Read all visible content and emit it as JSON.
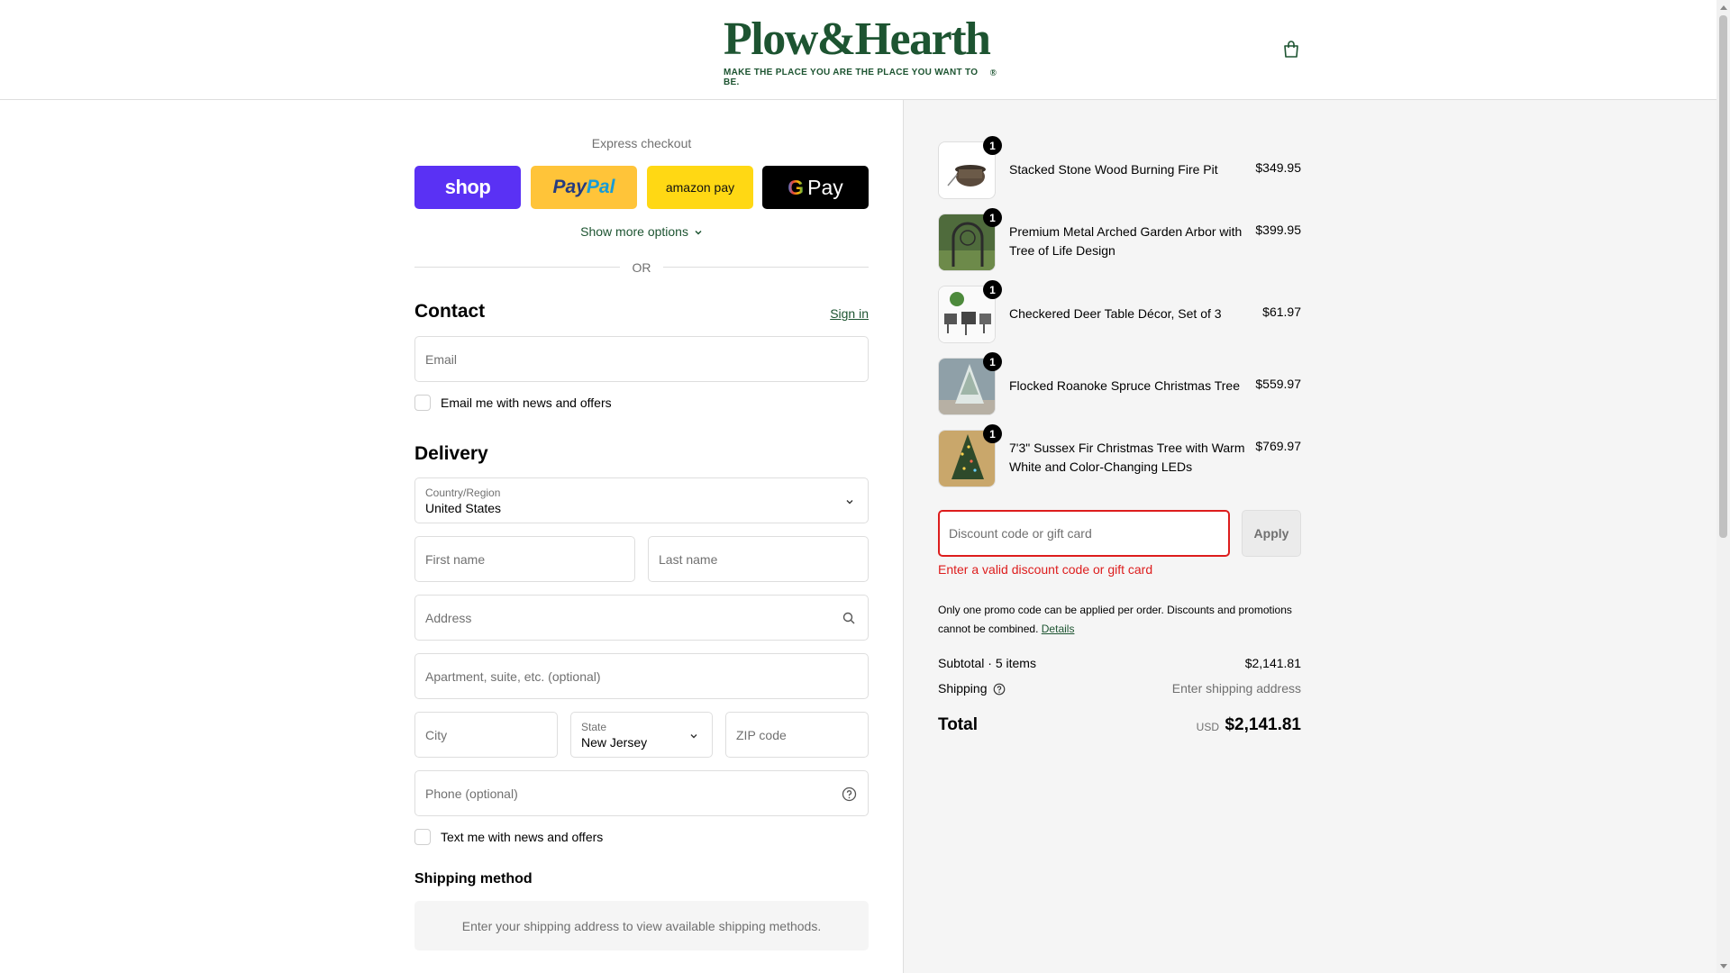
{
  "header": {
    "logo_word": "Plow&Hearth",
    "logo_reg": "®",
    "logo_tagline": "MAKE THE PLACE YOU ARE THE PLACE YOU WANT TO BE.",
    "brand_color": "#1d5431"
  },
  "express": {
    "title": "Express checkout",
    "shop_label": "shop",
    "paypal_label_1": "Pay",
    "paypal_label_2": "Pal",
    "amazon_label": "amazon pay",
    "gpay_g": "G",
    "gpay_label": "Pay",
    "more_options": "Show more options",
    "or": "OR"
  },
  "contact": {
    "title": "Contact",
    "sign_in": "Sign in",
    "email_placeholder": "Email",
    "email_news": "Email me with news and offers"
  },
  "delivery": {
    "title": "Delivery",
    "country_label": "Country/Region",
    "country_value": "United States",
    "first_name": "First name",
    "last_name": "Last name",
    "address": "Address",
    "apartment": "Apartment, suite, etc. (optional)",
    "city": "City",
    "state_label": "State",
    "state_value": "New Jersey",
    "zip": "ZIP code",
    "phone": "Phone (optional)",
    "text_news": "Text me with news and offers"
  },
  "shipping": {
    "title": "Shipping method",
    "message": "Enter your shipping address to view available shipping methods."
  },
  "items": [
    {
      "qty": "1",
      "name": "Stacked Stone Wood Burning Fire Pit",
      "price": "$349.95"
    },
    {
      "qty": "1",
      "name": "Premium Metal Arched Garden Arbor with Tree of Life Design",
      "price": "$399.95"
    },
    {
      "qty": "1",
      "name": "Checkered Deer Table Décor, Set of 3",
      "price": "$61.97"
    },
    {
      "qty": "1",
      "name": "Flocked Roanoke Spruce Christmas Tree",
      "price": "$559.97"
    },
    {
      "qty": "1",
      "name": "7'3\" Sussex Fir Christmas Tree with Warm White and Color-Changing LEDs",
      "price": "$769.97"
    }
  ],
  "discount": {
    "placeholder": "Discount code or gift card",
    "apply": "Apply",
    "error": "Enter a valid discount code or gift card",
    "note": "Only one promo code can be applied per order. Discounts and promotions cannot be combined.",
    "details": "Details"
  },
  "totals": {
    "subtotal_label": "Subtotal · 5 items",
    "subtotal_value": "$2,141.81",
    "shipping_label": "Shipping",
    "shipping_value": "Enter shipping address",
    "total_label": "Total",
    "currency": "USD",
    "total_value": "$2,141.81"
  }
}
